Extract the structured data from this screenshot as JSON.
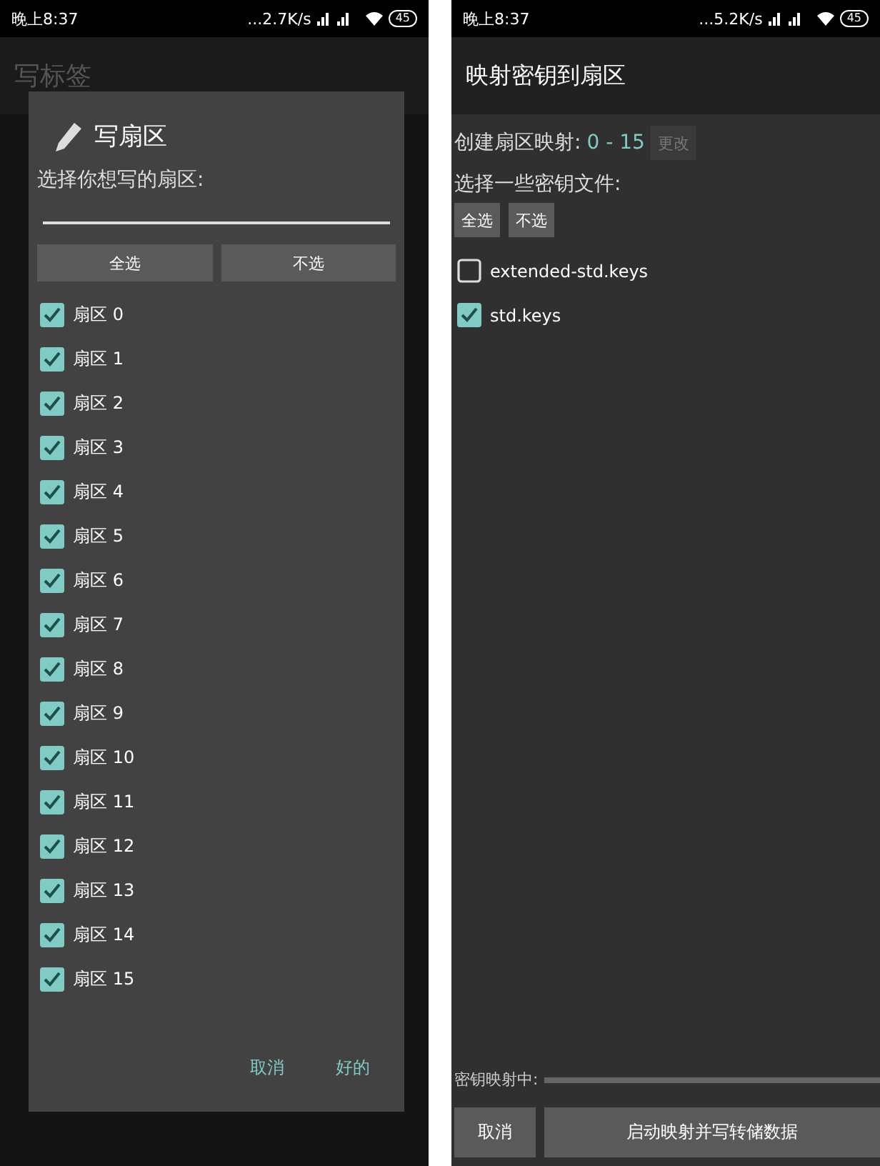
{
  "left_screen": {
    "status_bar": {
      "time": "晚上8:37",
      "speed": "...2.7K/s",
      "battery": "45"
    },
    "background": {
      "title": "写标签"
    },
    "dialog": {
      "title": "写扇区",
      "prompt": "选择你想写的扇区:",
      "buttons": [
        "全选",
        "不选"
      ],
      "sectors": [
        {
          "label": "扇区 0",
          "checked": true
        },
        {
          "label": "扇区 1",
          "checked": true
        },
        {
          "label": "扇区 2",
          "checked": true
        },
        {
          "label": "扇区 3",
          "checked": true
        },
        {
          "label": "扇区 4",
          "checked": true
        },
        {
          "label": "扇区 5",
          "checked": true
        },
        {
          "label": "扇区 6",
          "checked": true
        },
        {
          "label": "扇区 7",
          "checked": true
        },
        {
          "label": "扇区 8",
          "checked": true
        },
        {
          "label": "扇区 9",
          "checked": true
        },
        {
          "label": "扇区 10",
          "checked": true
        },
        {
          "label": "扇区 11",
          "checked": true
        },
        {
          "label": "扇区 12",
          "checked": true
        },
        {
          "label": "扇区 13",
          "checked": true
        },
        {
          "label": "扇区 14",
          "checked": true
        },
        {
          "label": "扇区 15",
          "checked": true
        }
      ],
      "actions": [
        "取消",
        "好的"
      ]
    }
  },
  "right_screen": {
    "status_bar": {
      "time": "晚上8:37",
      "speed": "...5.2K/s",
      "battery": "45"
    },
    "title": "映射密钥到扇区",
    "mapping": {
      "label": "创建扇区映射:",
      "value": "0 - 15",
      "button": {
        "label": "更改",
        "disabled": true
      }
    },
    "keys_label": "选择一些密钥文件:",
    "buttons": [
      "全选",
      "不选"
    ],
    "key_files": [
      {
        "label": "extended-std.keys",
        "checked": false
      },
      {
        "label": "std.keys",
        "checked": true
      }
    ],
    "progress": {
      "label": "密钥映射中:",
      "level": 0
    },
    "actions": [
      {
        "label": "取消",
        "kind": "small"
      },
      {
        "label": "启动映射并写转储数据",
        "kind": "wide"
      }
    ]
  }
}
